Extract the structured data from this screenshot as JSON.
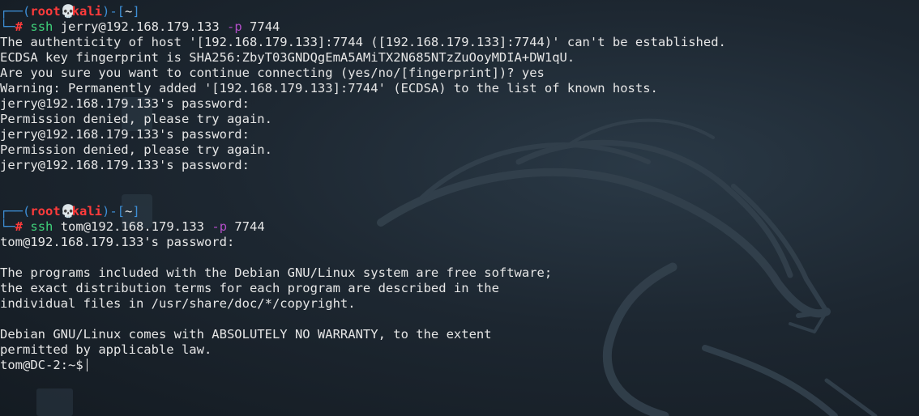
{
  "colors": {
    "prompt_frame": "#3d8fd6",
    "root_user": "#ff3b3b",
    "command": "#3fd17a",
    "flag": "#b24ec8",
    "text": "#e6e6e6"
  },
  "session1": {
    "prompt": {
      "corner_top": "┌──(",
      "user": "root",
      "skull_icon": "💀",
      "host": "kali",
      "dir_open": ")-[",
      "dir": "~",
      "dir_close": "]",
      "corner_bottom": "└─",
      "hash": "#"
    },
    "command": {
      "name": "ssh",
      "target": "jerry@192.168.179.133",
      "flag": "-p",
      "port": "7744"
    },
    "output": [
      "The authenticity of host '[192.168.179.133]:7744 ([192.168.179.133]:7744)' can't be established.",
      "ECDSA key fingerprint is SHA256:ZbyT03GNDQgEmA5AMiTX2N685NTzZuOoyMDIA+DW1qU.",
      "Are you sure you want to continue connecting (yes/no/[fingerprint])? yes",
      "Warning: Permanently added '[192.168.179.133]:7744' (ECDSA) to the list of known hosts.",
      "jerry@192.168.179.133's password: ",
      "Permission denied, please try again.",
      "jerry@192.168.179.133's password: ",
      "Permission denied, please try again.",
      "jerry@192.168.179.133's password: "
    ]
  },
  "session2": {
    "prompt": {
      "corner_top": "┌──(",
      "user": "root",
      "skull_icon": "💀",
      "host": "kali",
      "dir_open": ")-[",
      "dir": "~",
      "dir_close": "]",
      "corner_bottom": "└─",
      "hash": "#"
    },
    "command": {
      "name": "ssh",
      "target": "tom@192.168.179.133",
      "flag": "-p",
      "port": "7744"
    },
    "output": [
      "tom@192.168.179.133's password: ",
      "",
      "The programs included with the Debian GNU/Linux system are free software;",
      "the exact distribution terms for each program are described in the",
      "individual files in /usr/share/doc/*/copyright.",
      "",
      "Debian GNU/Linux comes with ABSOLUTELY NO WARRANTY, to the extent",
      "permitted by applicable law."
    ],
    "final_prompt": "tom@DC-2:~$"
  }
}
